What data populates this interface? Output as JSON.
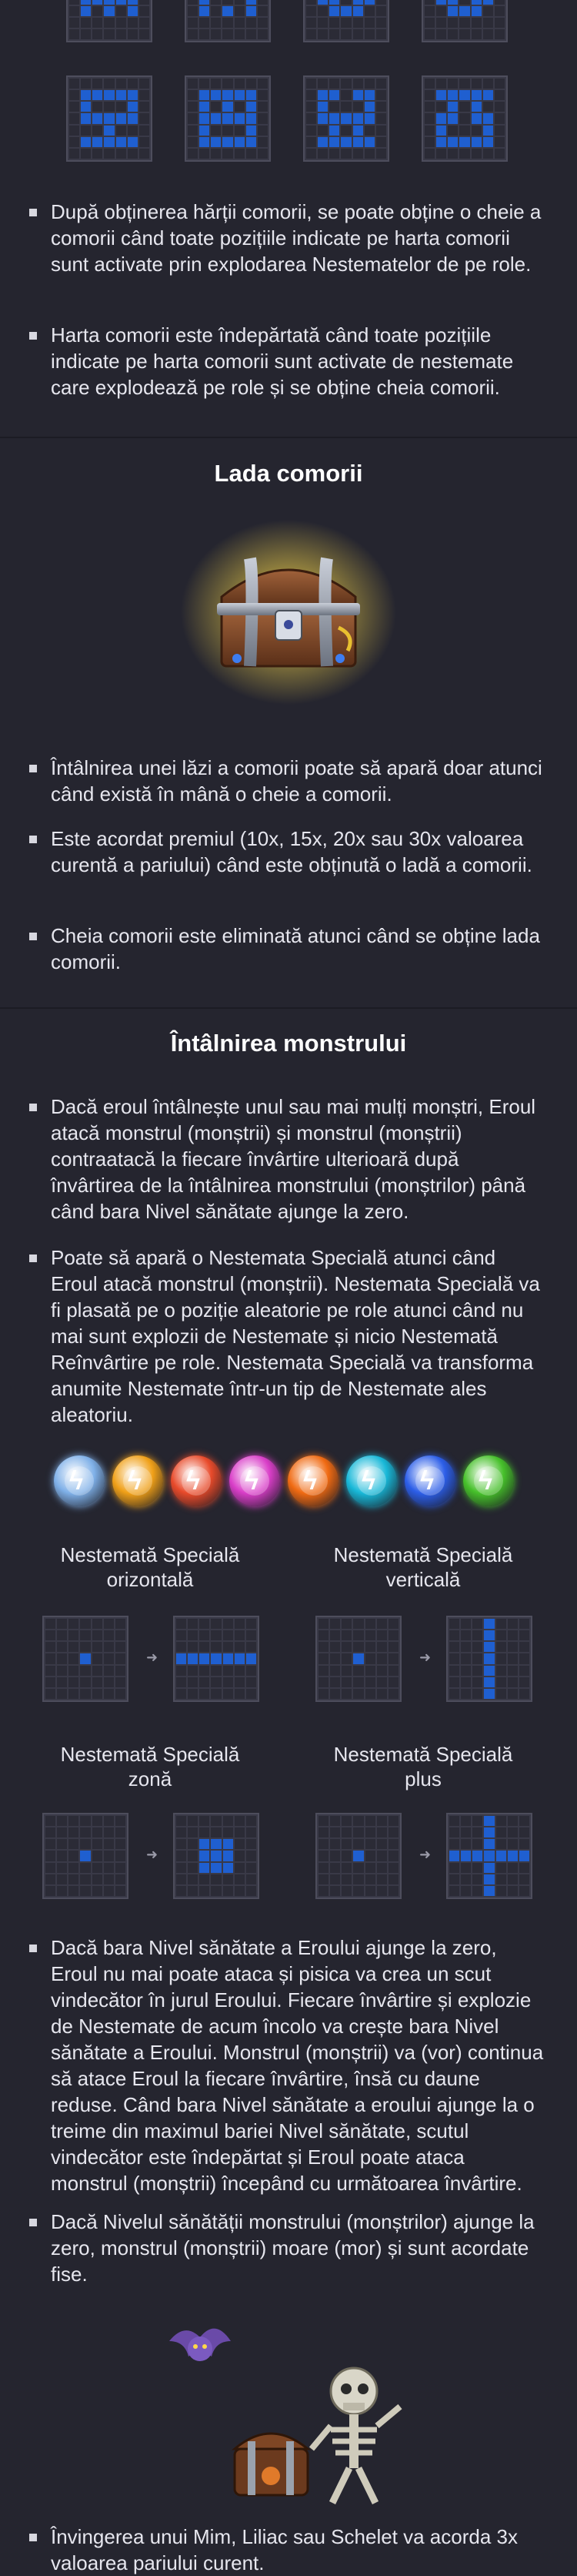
{
  "treasure_map": {
    "bullets": [
      "După obținerea hărții comorii, se poate obține o cheie a comorii când toate pozițiile indicate pe harta comorii sunt activate prin explodarea Nestematelor de pe role.",
      "Harta comorii este îndepărtată când toate pozițiile indicate pe harta comorii sunt activate de nestemate care explodează pe role și se obține cheia comorii."
    ]
  },
  "treasure_chest": {
    "title": "Lada comorii",
    "bullets": [
      "Întâlnirea unei lăzi a comorii poate să apară doar atunci când există în mână o cheie a comorii.",
      "Este acordat premiul (10x, 15x, 20x sau 30x valoarea curentă a pariului) când este obținută o ladă a comorii.",
      "Cheia comorii este eliminată atunci când se obține lada comorii."
    ]
  },
  "monster": {
    "title": "Întâlnirea monstrului",
    "bullets": [
      "Dacă eroul întâlnește unul sau mai mulți monștri, Eroul atacă monstrul (monștrii) și monstrul (monștrii) contraatacă la fiecare învârtire ulterioară după învârtirea de la întâlnirea monstrului (monștrilor) până când bara Nivel sănătate ajunge la zero.",
      "Poate să apară o Nestemata Specială atunci când Eroul atacă monstrul (monștrii). Nestemata Specială va fi plasată pe o poziție aleatorie pe role atunci când nu mai sunt explozii de Nestemate și nicio Nestemată Reînvârtire pe role. Nestemata Specială va transforma anumite Nestemate într-un tip de Nestemate ales aleatoriu."
    ],
    "gem_types": [
      {
        "icon": "lightning-gem-icon",
        "color": "#7fb0e8"
      },
      {
        "icon": "lightning-gem-icon",
        "color": "#f0a018"
      },
      {
        "icon": "lightning-gem-icon",
        "color": "#e84a2a"
      },
      {
        "icon": "lightning-gem-icon",
        "color": "#d93ec8"
      },
      {
        "icon": "lightning-gem-icon",
        "color": "#f06a12"
      },
      {
        "icon": "lightning-gem-icon",
        "color": "#18b8d8"
      },
      {
        "icon": "lightning-gem-icon",
        "color": "#2c5ee8"
      },
      {
        "icon": "lightning-gem-icon",
        "color": "#46c02a"
      }
    ],
    "special_labels": {
      "horizontal": "Nestemată Specială orizontală",
      "vertical": "Nestemată Specială verticală",
      "zone": "Nestemată Specială zonă",
      "plus": "Nestemată Specială plus"
    },
    "bullets_after": [
      "Dacă bara Nivel sănătate a Eroului ajunge la zero, Eroul nu mai poate ataca și pisica va crea un scut vindecător în jurul Eroului. Fiecare învârtire și explozie de Nestemate de acum încolo va crește bara Nivel sănătate a Eroului. Monstrul (monștrii) va (vor) continua să atace Eroul la fiecare învârtire, însă cu daune reduse. Când bara Nivel sănătate a eroului ajunge la o treime din maximul bariei Nivel sănătate, scutul vindecător este îndepărtat și Eroul poate ataca monstrul (monștrii) începând cu următoarea învârtire.",
      "Dacă Nivelul sănătății monstrului (monștrilor) ajunge la zero, monstrul (monștrii) moare (mor) și sunt acordate fise."
    ],
    "bullets_final": [
      "Învingerea unui Mim, Liliac sau Schelet va acorda 3x valoarea pariului curent."
    ]
  },
  "colors": {
    "background": "#25252f",
    "accent_blue": "#1f5fd0",
    "chest_glow": "#f3d34a"
  }
}
